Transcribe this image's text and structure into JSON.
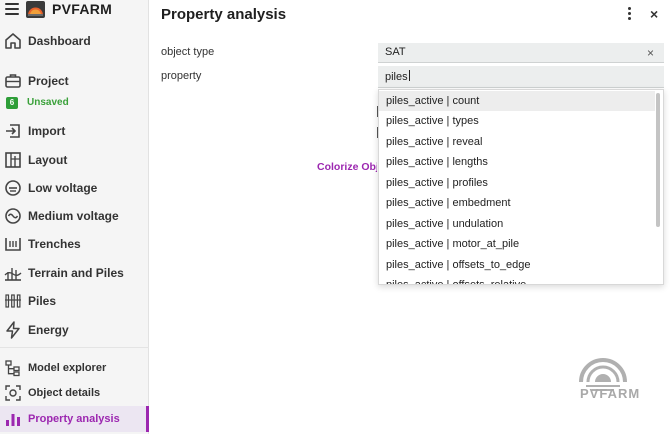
{
  "app": {
    "brand": "PVFARM"
  },
  "sidebar": {
    "items": [
      {
        "label": "Dashboard",
        "icon": "home-icon"
      },
      {
        "label": "Project",
        "icon": "briefcase-icon",
        "badge": "6",
        "status": "Unsaved"
      },
      {
        "label": "Import",
        "icon": "import-icon"
      },
      {
        "label": "Layout",
        "icon": "layout-icon"
      },
      {
        "label": "Low voltage",
        "icon": "low-voltage-icon"
      },
      {
        "label": "Medium voltage",
        "icon": "medium-voltage-icon"
      },
      {
        "label": "Trenches",
        "icon": "trenches-icon"
      },
      {
        "label": "Terrain and Piles",
        "icon": "terrain-icon"
      },
      {
        "label": "Piles",
        "icon": "piles-icon"
      },
      {
        "label": "Energy",
        "icon": "energy-icon"
      }
    ],
    "tools": [
      {
        "label": "Model explorer",
        "icon": "tree-icon"
      },
      {
        "label": "Object details",
        "icon": "object-details-icon"
      },
      {
        "label": "Property analysis",
        "icon": "bar-chart-icon",
        "active": true
      }
    ]
  },
  "panel": {
    "title": "Property analysis",
    "object_type_label": "object type",
    "object_type_value": "SAT",
    "clear_symbol": "×",
    "close_symbol": "×",
    "property_label": "property",
    "property_value": "piles",
    "colorize_label": "Colorize Objects"
  },
  "dropdown": {
    "options": [
      "piles_active | count",
      "piles_active | types",
      "piles_active | reveal",
      "piles_active | lengths",
      "piles_active | profiles",
      "piles_active | embedment",
      "piles_active | undulation",
      "piles_active | motor_at_pile",
      "piles_active | offsets_to_edge",
      "piles_active | offsets_relative"
    ],
    "highlighted_index": 0
  },
  "watermark": {
    "text": "PVFARM"
  },
  "colors": {
    "accent": "#9c27b0",
    "unsaved": "#2e9e38"
  }
}
